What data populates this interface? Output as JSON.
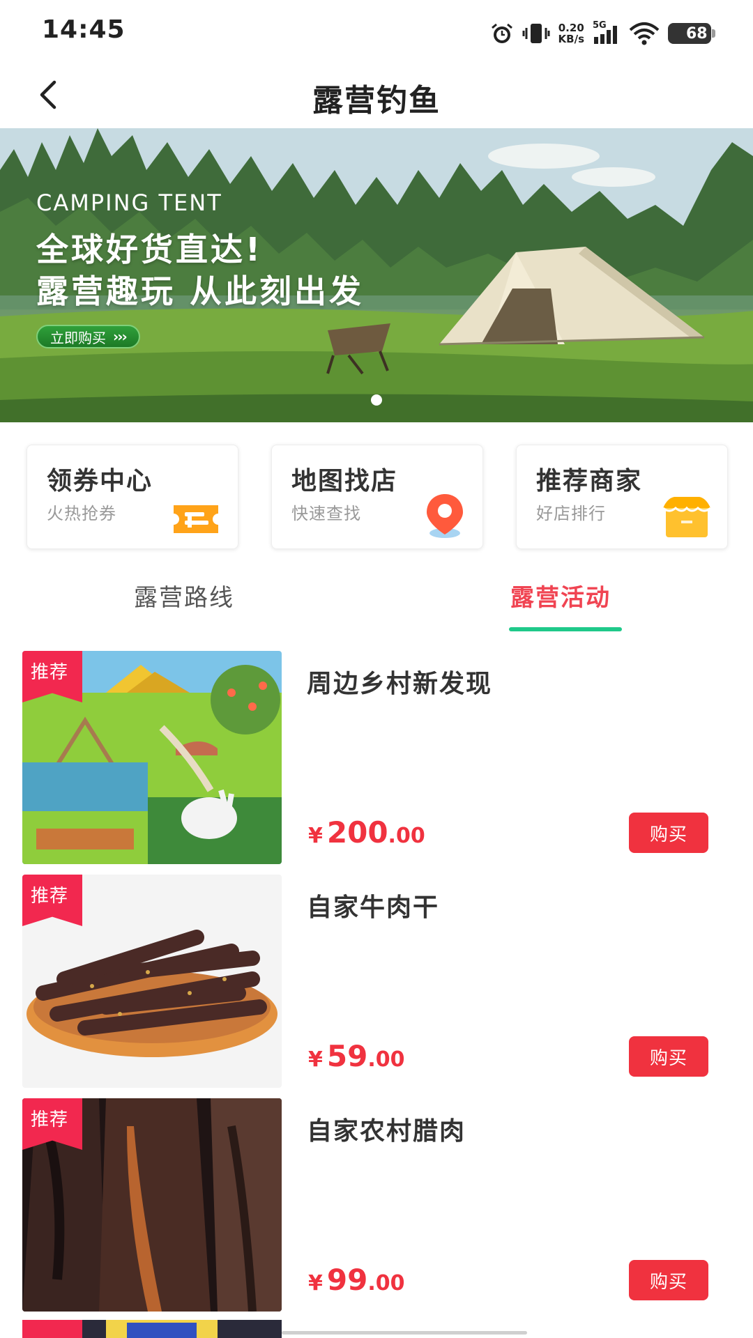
{
  "status_bar": {
    "time": "14:45",
    "net_speed_value": "0.20",
    "net_speed_unit": "KB/s",
    "network_type": "5G",
    "battery": "68"
  },
  "nav": {
    "title": "露营钓鱼"
  },
  "banner": {
    "eyebrow": "CAMPING TENT",
    "line1": "全球好货直达!",
    "line2": "露营趣玩 从此刻出发",
    "cta": "立即购买",
    "cta_arrows": "›››"
  },
  "quick_entries": [
    {
      "title": "领券中心",
      "subtitle": "火热抢券",
      "icon": "ticket-icon"
    },
    {
      "title": "地图找店",
      "subtitle": "快速查找",
      "icon": "map-pin-icon"
    },
    {
      "title": "推荐商家",
      "subtitle": "好店排行",
      "icon": "store-icon"
    }
  ],
  "tabs": [
    {
      "label": "露营路线",
      "active": false
    },
    {
      "label": "露营活动",
      "active": true
    }
  ],
  "products": [
    {
      "tag": "推荐",
      "name": "周边乡村新发现",
      "currency": "¥",
      "price_int": "200",
      "price_dec": ".00",
      "buy_label": "购买"
    },
    {
      "tag": "推荐",
      "name": "自家牛肉干",
      "currency": "¥",
      "price_int": "59",
      "price_dec": ".00",
      "buy_label": "购买"
    },
    {
      "tag": "推荐",
      "name": "自家农村腊肉",
      "currency": "¥",
      "price_int": "99",
      "price_dec": ".00",
      "buy_label": "购买"
    }
  ],
  "colors": {
    "accent_red": "#f0323f",
    "tab_indicator": "#1fc98a",
    "tag_red": "#f2284f"
  }
}
